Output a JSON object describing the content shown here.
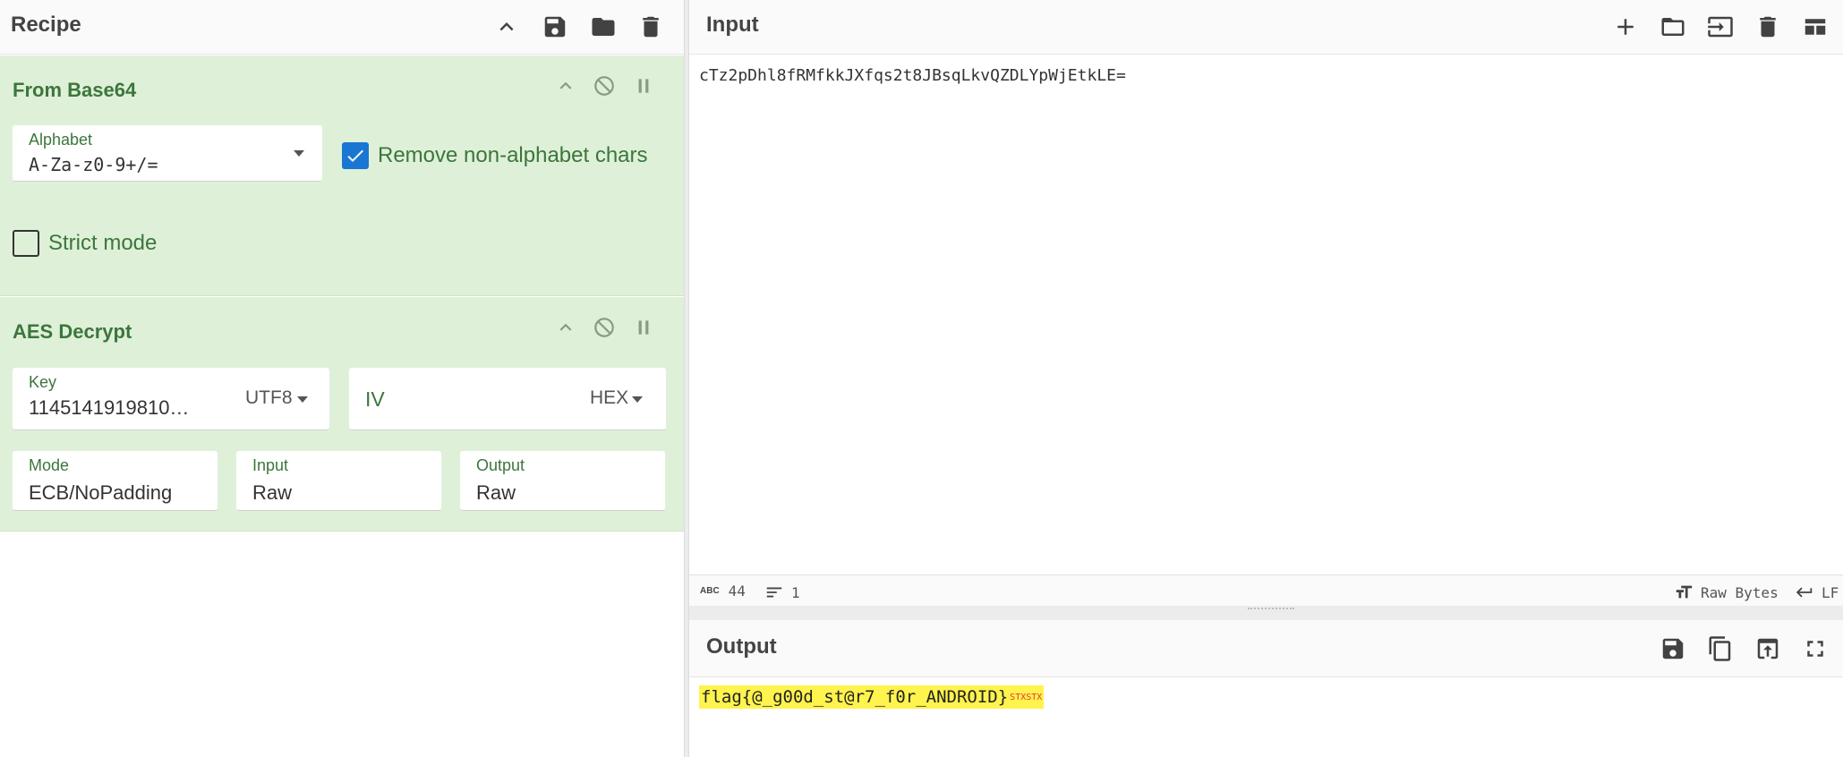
{
  "recipe": {
    "title": "Recipe",
    "operations": {
      "from_base64": {
        "title": "From Base64",
        "alphabet_label": "Alphabet",
        "alphabet_value": "A-Za-z0-9+/=",
        "remove_nonalpha_label": "Remove non-alphabet chars",
        "remove_nonalpha_checked": true,
        "strict_mode_label": "Strict mode",
        "strict_mode_checked": false
      },
      "aes_decrypt": {
        "title": "AES Decrypt",
        "key_label": "Key",
        "key_value": "1145141919810…",
        "key_encoding": "UTF8",
        "iv_placeholder": "IV",
        "iv_encoding": "HEX",
        "mode_label": "Mode",
        "mode_value": "ECB/NoPadding",
        "input_label": "Input",
        "input_value": "Raw",
        "output_label": "Output",
        "output_value": "Raw"
      }
    }
  },
  "input": {
    "title": "Input",
    "text": "cTz2pDhl8fRMfkkJXfqs2t8JBsqLkvQZDLYpWjEtkLE=",
    "status": {
      "length_icon_text": "ABC",
      "length": "44",
      "lines": "1",
      "encoding": "Raw Bytes",
      "eol": "LF"
    }
  },
  "output": {
    "title": "Output",
    "text": "flag{@_g00d_st@r7_f0r_ANDROID}",
    "control_chars": "STXSTX"
  },
  "colors": {
    "operation_bg": "#dff0d8",
    "operation_text": "#3c763d",
    "checkbox_checked": "#1976d2",
    "output_highlight": "#fff34d",
    "control_char": "#e53935"
  },
  "icons": {
    "recipe_header": [
      "chevron-up-icon",
      "save-icon",
      "folder-icon",
      "trash-icon"
    ],
    "operation_controls": [
      "chevron-up-icon",
      "disable-icon",
      "pause-icon"
    ],
    "input_header": [
      "plus-icon",
      "folder-icon",
      "input-icon",
      "trash-icon",
      "layout-icon"
    ],
    "output_header": [
      "save-icon",
      "copy-icon",
      "replace-input-icon",
      "fullscreen-icon"
    ]
  }
}
